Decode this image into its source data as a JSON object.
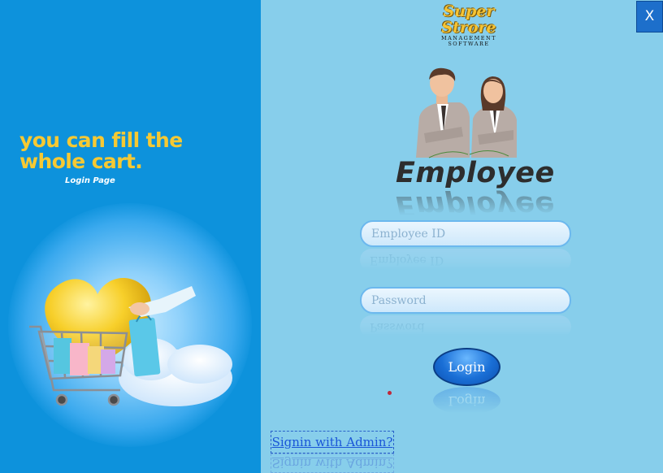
{
  "window": {
    "close_label": "X"
  },
  "left_panel": {
    "tagline_line1": "you can fill the",
    "tagline_line2": "whole cart.",
    "subtitle": "Login Page",
    "background_color": "#0d92dc",
    "tagline_color": "#f6c933"
  },
  "logo": {
    "line1": "Super",
    "line2": "Strore",
    "line3": "MANAGEMENT",
    "line4": "SOFTWARE"
  },
  "heading": "Employee",
  "form": {
    "employee_id_placeholder": "Employee ID",
    "password_placeholder": "Password",
    "login_label": "Login",
    "admin_link": "Signin with Admin?"
  },
  "colors": {
    "right_background": "#87ceeb",
    "button": "#1a6fd6",
    "link": "#1a56d8"
  }
}
